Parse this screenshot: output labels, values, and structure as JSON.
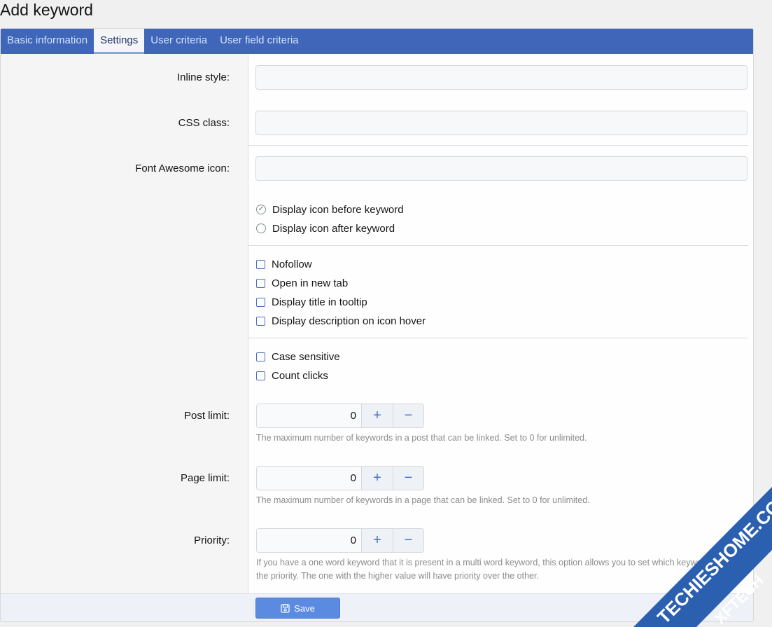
{
  "page": {
    "title": "Add keyword"
  },
  "tabs": [
    {
      "label": "Basic information",
      "active": false
    },
    {
      "label": "Settings",
      "active": true
    },
    {
      "label": "User criteria",
      "active": false
    },
    {
      "label": "User field criteria",
      "active": false
    }
  ],
  "fields": {
    "inline_style": {
      "label": "Inline style:",
      "value": ""
    },
    "css_class": {
      "label": "CSS class:",
      "value": ""
    },
    "fa_icon": {
      "label": "Font Awesome icon:",
      "value": ""
    }
  },
  "icon_position": {
    "options": [
      {
        "label": "Display icon before keyword",
        "selected": true
      },
      {
        "label": "Display icon after keyword",
        "selected": false
      }
    ]
  },
  "link_options": [
    {
      "label": "Nofollow",
      "checked": false
    },
    {
      "label": "Open in new tab",
      "checked": false
    },
    {
      "label": "Display title in tooltip",
      "checked": false
    },
    {
      "label": "Display description on icon hover",
      "checked": false
    }
  ],
  "match_options": [
    {
      "label": "Case sensitive",
      "checked": false
    },
    {
      "label": "Count clicks",
      "checked": false
    }
  ],
  "post_limit": {
    "label": "Post limit:",
    "value": "0",
    "hint": "The maximum number of keywords in a post that can be linked. Set to 0 for unlimited."
  },
  "page_limit": {
    "label": "Page limit:",
    "value": "0",
    "hint": "The maximum number of keywords in a page that can be linked. Set to 0 for unlimited."
  },
  "priority": {
    "label": "Priority:",
    "value": "0",
    "hint": "If you have a one word keyword that it is present in a multi word keyword, this option allows you to set which keyword will have the priority. The one with the higher value will have priority over the other."
  },
  "stepper_glyphs": {
    "plus": "+",
    "minus": "−"
  },
  "footer": {
    "save_label": "Save"
  },
  "watermark": {
    "line1": "TECHIESHOME.COM",
    "line2": "XFTECH"
  },
  "colors": {
    "tab_bar": "#3f66b8",
    "save_button": "#5b8be0",
    "watermark": "#2b5fb0"
  }
}
